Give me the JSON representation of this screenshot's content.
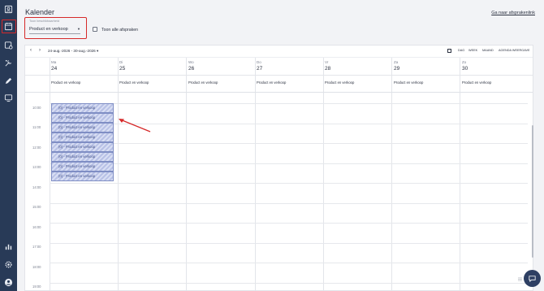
{
  "page": {
    "title": "Kalender",
    "link": "Ga naar afsprakenlink"
  },
  "filter": {
    "label": "Toon beschikbaarheid",
    "value": "Product en verkoop"
  },
  "checkbox": {
    "label": "Toon alle afspraken"
  },
  "toolbar": {
    "range": "24-aug.-2026 - 30-aug.-2026",
    "views": [
      "DAG",
      "WEEK",
      "MAAND",
      "AGENDA WEERGAVE"
    ]
  },
  "days": [
    {
      "name": "Ma",
      "num": "24",
      "schedule": "Product en verkoop"
    },
    {
      "name": "Di",
      "num": "25",
      "schedule": "Product en verkoop"
    },
    {
      "name": "Wo",
      "num": "26",
      "schedule": "Product en verkoop"
    },
    {
      "name": "Do",
      "num": "27",
      "schedule": "Product en verkoop"
    },
    {
      "name": "Vr",
      "num": "28",
      "schedule": "Product en verkoop"
    },
    {
      "name": "Za",
      "num": "29",
      "schedule": "Product en verkoop"
    },
    {
      "name": "Zo",
      "num": "30",
      "schedule": "Product en verkoop"
    }
  ],
  "hours": [
    "10:00",
    "11:00",
    "12:00",
    "13:00",
    "14:00",
    "15:00",
    "16:00",
    "17:00",
    "18:00",
    "19:00"
  ],
  "appointments": [
    "(0) - Product en verkoop",
    "(0) - Product en verkoop",
    "(0) - Product en verkoop",
    "(0) - Product en verkoop",
    "(0) - Product en verkoop",
    "(0) - Product en verkoop",
    "(0) - Product en verkoop",
    "(0) - Product en verkoop"
  ],
  "colors": {
    "sidebar": "#283a57",
    "highlight": "#d62a2a",
    "appointment": "#b8c1e6"
  },
  "icons": [
    "contact-icon",
    "calendar-icon",
    "appointment-icon",
    "tools-icon",
    "edit-icon",
    "monitor-icon",
    "stats-icon",
    "settings-icon",
    "profile-icon",
    "chat-icon"
  ]
}
